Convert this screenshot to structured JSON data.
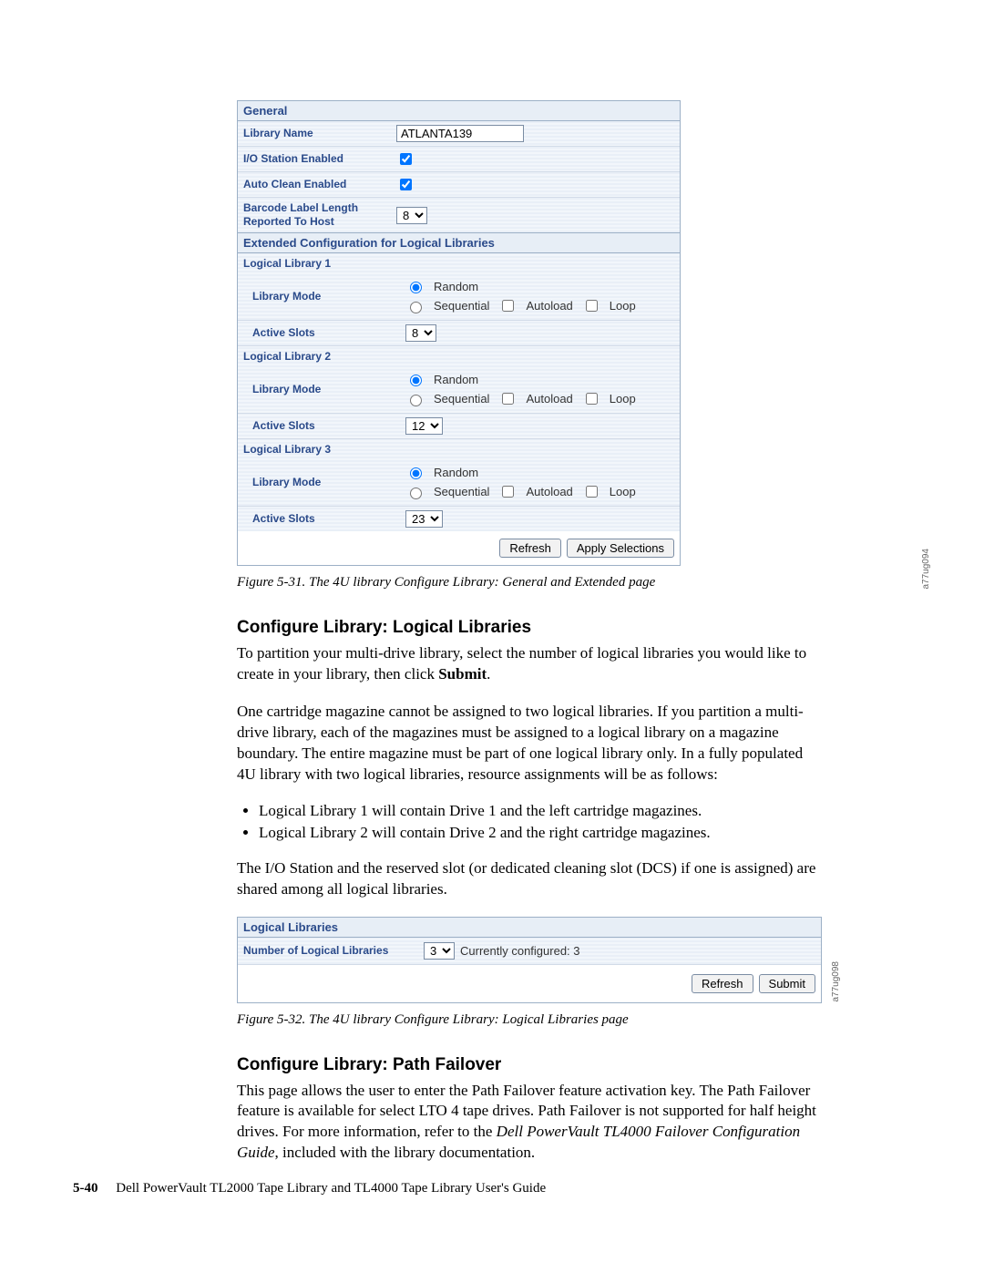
{
  "fig1": {
    "sections": {
      "general": "General",
      "extended": "Extended Configuration for Logical Libraries"
    },
    "general": {
      "libraryNameLabel": "Library Name",
      "libraryName": "ATLANTA139",
      "ioStationLabel": "I/O Station Enabled",
      "ioStation": true,
      "autoCleanLabel": "Auto Clean Enabled",
      "autoClean": true,
      "barcodeLabel": "Barcode Label Length Reported To Host",
      "barcodeValue": "8"
    },
    "modeOptions": {
      "random": "Random",
      "sequential": "Sequential",
      "autoload": "Autoload",
      "loop": "Loop"
    },
    "logical": [
      {
        "title": "Logical Library 1",
        "modeLabel": "Library Mode",
        "mode": "random",
        "slotsLabel": "Active Slots",
        "slots": "8"
      },
      {
        "title": "Logical Library 2",
        "modeLabel": "Library Mode",
        "mode": "random",
        "slotsLabel": "Active Slots",
        "slots": "12"
      },
      {
        "title": "Logical Library 3",
        "modeLabel": "Library Mode",
        "mode": "random",
        "slotsLabel": "Active Slots",
        "slots": "23"
      }
    ],
    "buttons": {
      "refresh": "Refresh",
      "apply": "Apply Selections"
    },
    "sideId": "a77ug094",
    "caption": "Figure 5-31. The 4U library Configure Library: General and Extended page"
  },
  "section1": {
    "heading": "Configure Library: Logical Libraries",
    "para1a": "To partition your multi-drive library, select the number of logical libraries you would like to create in your library, then click ",
    "para1b": "Submit",
    "para1c": ".",
    "para2": "One cartridge magazine cannot be assigned to two logical libraries. If you partition a multi-drive library, each of the magazines must be assigned to a logical library on a magazine boundary. The entire magazine must be part of one logical library only. In a fully populated 4U library with two logical libraries, resource assignments will be as follows:",
    "li1": "Logical Library 1 will contain Drive 1 and the left cartridge magazines.",
    "li2": "Logical Library 2 will contain Drive 2 and the right cartridge magazines.",
    "para3": "The I/O Station and the reserved slot (or dedicated cleaning slot (DCS) if one is assigned) are shared among all logical libraries."
  },
  "fig2": {
    "sectHead": "Logical Libraries",
    "numLabel": "Number of Logical Libraries",
    "numValue": "3",
    "currentText": "Currently configured: 3",
    "buttons": {
      "refresh": "Refresh",
      "submit": "Submit"
    },
    "sideId": "a77ug098",
    "caption": "Figure 5-32. The 4U library Configure Library: Logical Libraries page"
  },
  "section2": {
    "heading": "Configure Library: Path Failover",
    "para1a": "This page allows the user to enter the Path Failover feature activation key. The Path Failover feature is available for select LTO 4 tape drives. Path Failover is not supported for half height drives. For more information, refer to the ",
    "para1b": "Dell PowerVault TL4000 Failover Configuration Guide",
    "para1c": ", included with the library documentation."
  },
  "footer": {
    "pageNum": "5-40",
    "bookTitle": "Dell PowerVault TL2000 Tape Library and TL4000 Tape Library User's Guide"
  }
}
